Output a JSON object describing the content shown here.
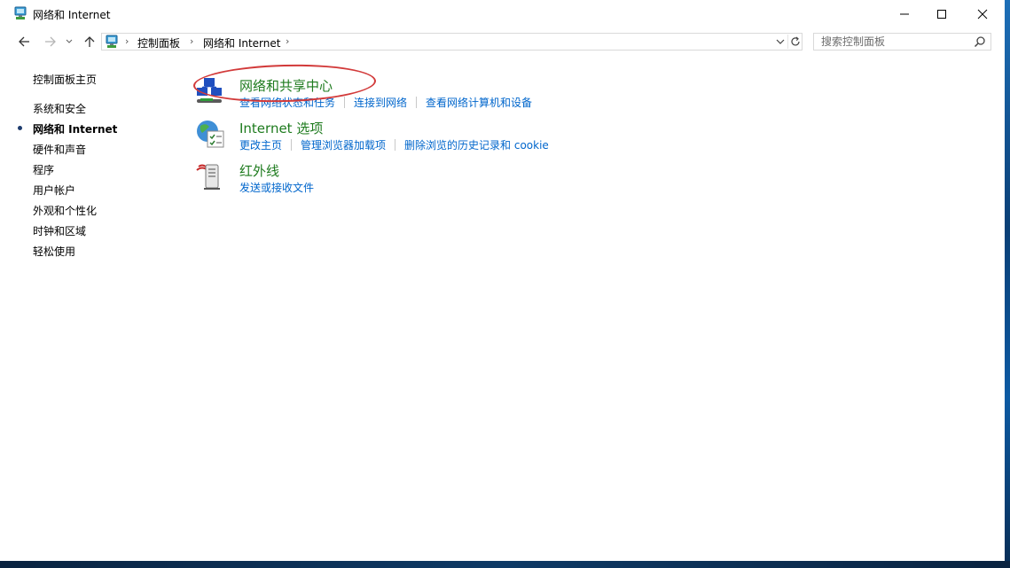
{
  "window": {
    "title": "网络和 Internet"
  },
  "navigation": {
    "breadcrumbs": [
      "控制面板",
      "网络和 Internet"
    ],
    "search_placeholder": "搜索控制面板"
  },
  "sidebar": {
    "home": "控制面板主页",
    "items": [
      {
        "label": "系统和安全",
        "active": false
      },
      {
        "label": "网络和 Internet",
        "active": true
      },
      {
        "label": "硬件和声音",
        "active": false
      },
      {
        "label": "程序",
        "active": false
      },
      {
        "label": "用户帐户",
        "active": false
      },
      {
        "label": "外观和个性化",
        "active": false
      },
      {
        "label": "时钟和区域",
        "active": false
      },
      {
        "label": "轻松使用",
        "active": false
      }
    ]
  },
  "categories": [
    {
      "title": "网络和共享中心",
      "icon": "network-sharing-icon",
      "links": [
        "查看网络状态和任务",
        "连接到网络",
        "查看网络计算机和设备"
      ]
    },
    {
      "title": "Internet 选项",
      "icon": "internet-options-icon",
      "links": [
        "更改主页",
        "管理浏览器加载项",
        "删除浏览的历史记录和 cookie"
      ]
    },
    {
      "title": "红外线",
      "icon": "infrared-icon",
      "links": [
        "发送或接收文件"
      ]
    }
  ],
  "colors": {
    "category_title": "#1e7b1e",
    "link": "#0066cc",
    "annotation_oval": "#d23a3a"
  }
}
